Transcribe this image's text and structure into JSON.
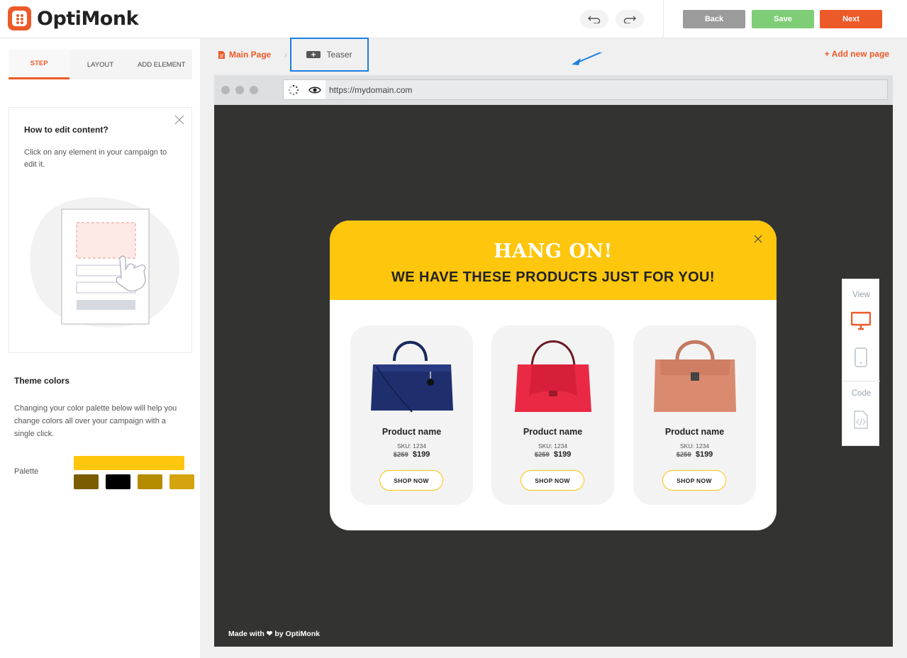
{
  "header": {
    "brand": "OptiMonk",
    "back_label": "Back",
    "save_label": "Save",
    "next_label": "Next"
  },
  "sidebar": {
    "tabs": [
      {
        "label": "STEP"
      },
      {
        "label": "LAYOUT"
      },
      {
        "label": "ADD ELEMENT"
      }
    ],
    "help": {
      "title": "How to edit content?",
      "text": "Click on any element in your campaign to edit it."
    },
    "theme": {
      "title": "Theme colors",
      "text": "Changing your color palette below will help you change colors all over your campaign with a single click.",
      "palette_label": "Palette",
      "main_color": "#fec60c",
      "colors": [
        "#7b5d00",
        "#000000",
        "#b58c00",
        "#d4a30d"
      ]
    }
  },
  "pages": {
    "main_page": "Main Page",
    "teaser": "Teaser",
    "add_new_page": "+ Add new page"
  },
  "browser": {
    "url": "https://mydomain.com",
    "footer": "Made with ❤ by OptiMonk"
  },
  "popup": {
    "title": "HANG ON!",
    "subtitle": "WE HAVE THESE PRODUCTS JUST FOR YOU!",
    "accent_color": "#fec60c",
    "products": [
      {
        "name": "Product name",
        "sku": "SKU: 1234",
        "old_price": "$259",
        "price": "$199",
        "button": "SHOP NOW",
        "bag_color": "#1f2f6e"
      },
      {
        "name": "Product name",
        "sku": "SKU: 1234",
        "old_price": "$259",
        "price": "$199",
        "button": "SHOP NOW",
        "bag_color": "#ea2a44"
      },
      {
        "name": "Product name",
        "sku": "SKU: 1234",
        "old_price": "$259",
        "price": "$199",
        "button": "SHOP NOW",
        "bag_color": "#d98a6f"
      }
    ]
  },
  "view_panel": {
    "view_label": "View",
    "code_label": "Code"
  }
}
